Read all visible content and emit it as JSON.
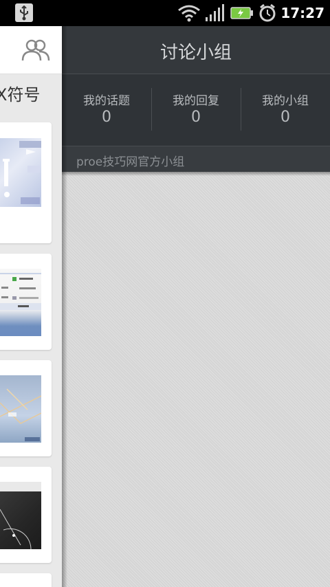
{
  "status_bar": {
    "time": "17:27",
    "icons": [
      "usb-icon",
      "wifi-icon",
      "signal-icon",
      "battery-charging-icon",
      "alarm-icon"
    ]
  },
  "feed": {
    "header_icon": "group-icon",
    "title_fragment": "X符号",
    "cards": [
      {
        "thumbnail": "image-1"
      },
      {
        "thumbnail": "image-2"
      },
      {
        "thumbnail": "image-3"
      },
      {
        "thumbnail": "image-4"
      }
    ]
  },
  "header": {
    "title": "讨论小组"
  },
  "stats": [
    {
      "label": "我的话题",
      "value": "0"
    },
    {
      "label": "我的回复",
      "value": "0"
    },
    {
      "label": "我的小组",
      "value": "0"
    }
  ],
  "group": {
    "name": "proe技巧网官方小组"
  }
}
